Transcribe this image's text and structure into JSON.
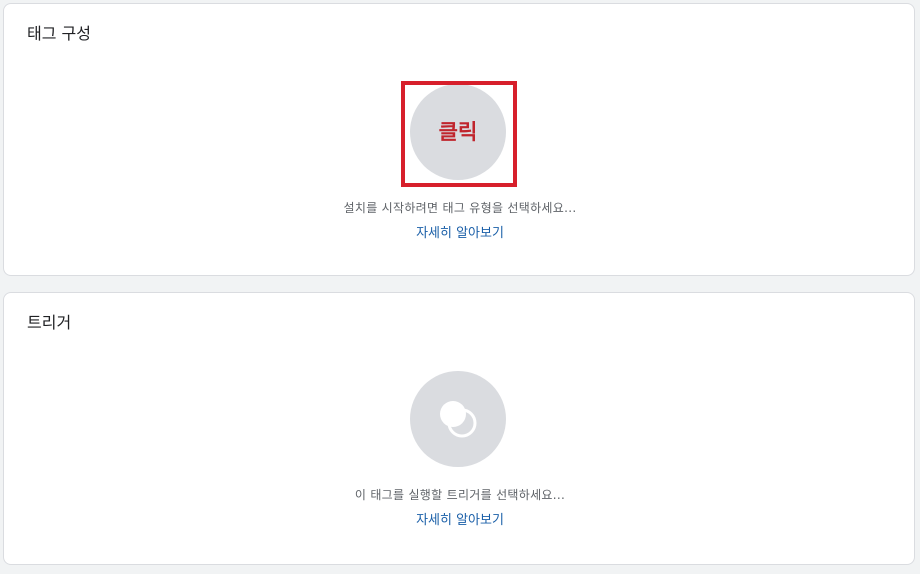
{
  "tag_config": {
    "title": "태그 구성",
    "annotation_label": "클릭",
    "hint": "설치를 시작하려면 태그 유형을 선택하세요...",
    "learn_more": "자세히 알아보기"
  },
  "triggers": {
    "title": "트리거",
    "icon": "trigger-icon",
    "hint": "이 태그를 실행할 트리거를 선택하세요...",
    "learn_more": "자세히 알아보기"
  },
  "colors": {
    "placeholder_circle": "#dadce0",
    "annotation_red": "#d71f2b",
    "link_blue": "#1a5fa8",
    "page_background": "#f1f3f4"
  }
}
